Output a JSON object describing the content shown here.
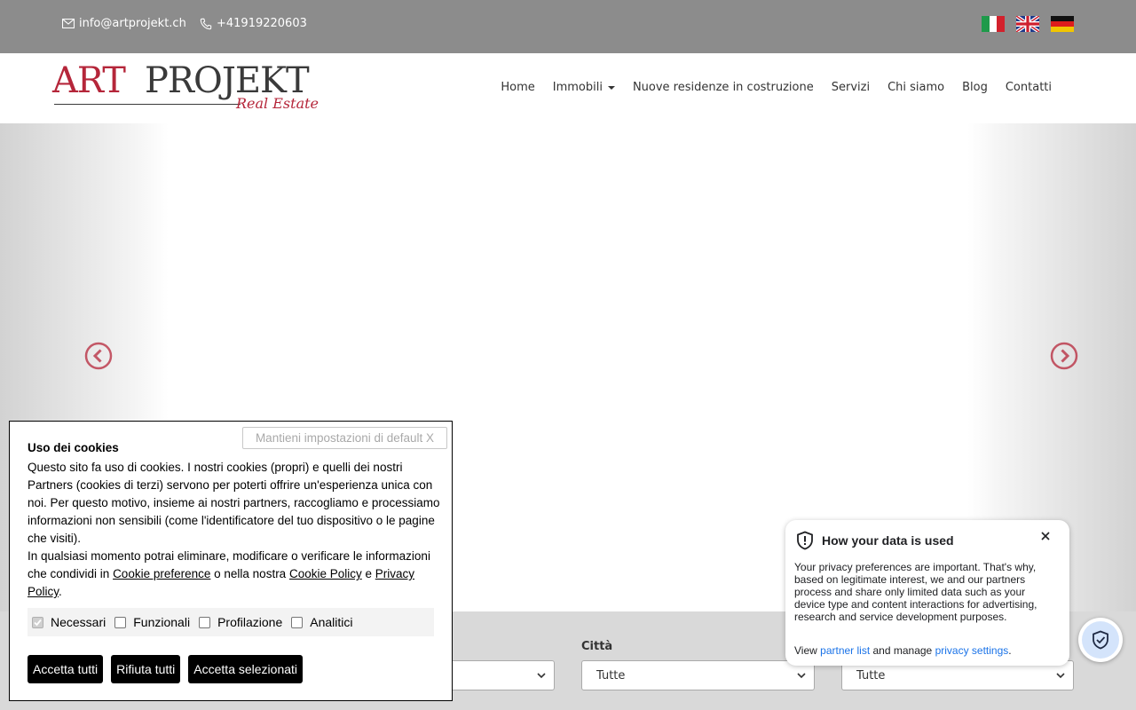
{
  "topbar": {
    "email": "info@artprojekt.ch",
    "phone": "+41919220603",
    "languages": [
      "it",
      "en",
      "de"
    ]
  },
  "logo": {
    "part1": "ART",
    "part2": "PROJEKT",
    "tagline": "Real Estate"
  },
  "nav": {
    "items": [
      "Home",
      "Immobili",
      "Nuove residenze in costruzione",
      "Servizi",
      "Chi siamo",
      "Blog",
      "Contatti"
    ]
  },
  "search": {
    "city_label": "Città",
    "city_value": "Tutte",
    "fourth_value": "Tutte"
  },
  "cookie": {
    "keep_default": "Mantieni impostazioni di default X",
    "title": "Uso dei cookies",
    "p1": "Questo sito fa uso di cookies. I nostri cookies (propri) e quelli dei nostri Partners (cookies di terzi) servono per poterti offrire un'esperienza unica con noi. Per questo motivo, insieme ai nostri partners, raccogliamo e processiamo informazioni non sensibili (come l'identificatore del tuo dispositivo o le pagine che visiti).",
    "p2_start": "In qualsiasi momento potrai eliminare, modificare o verificare le informazioni che condividi in ",
    "link_cookie_pref": "Cookie preference",
    "p2_mid": " o nella nostra ",
    "link_cookie_policy": "Cookie Policy",
    "p2_and": " e ",
    "link_privacy": "Privacy Policy",
    "p2_end": ".",
    "checks": [
      "Necessari",
      "Funzionali",
      "Profilazione",
      "Analitici"
    ],
    "btn_accept_all": "Accetta tutti",
    "btn_reject_all": "Rifiuta tutti",
    "btn_accept_selected": "Accetta selezionati"
  },
  "privacy": {
    "title": "How your data is used",
    "text": "Your privacy preferences are important. That's why, based on legitimate interest, we and our partners process and share only limited data such as your device type and content interactions for advertising, research and service development purposes.",
    "foot_start": "View ",
    "link_partners": "partner list",
    "foot_mid": " and manage ",
    "link_settings": "privacy settings",
    "foot_end": "."
  },
  "colors": {
    "brand_red": "#b5263a",
    "topbar_gray": "#8c8c8c",
    "link_blue": "#1a73e8"
  }
}
